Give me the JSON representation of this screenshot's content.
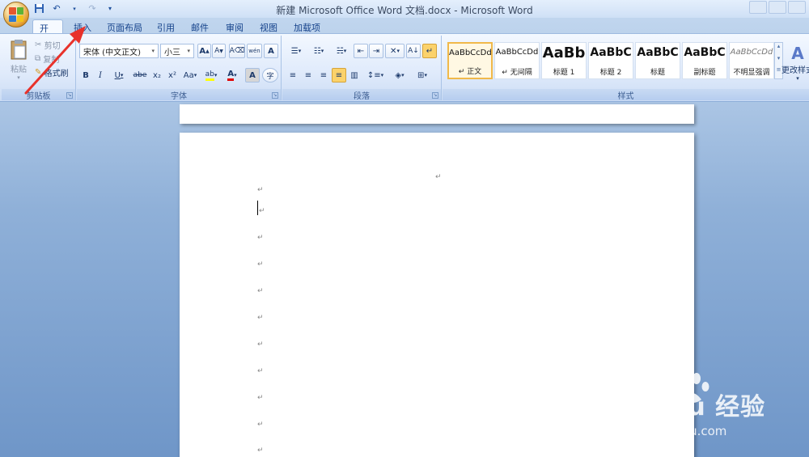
{
  "window": {
    "title": "新建 Microsoft Office Word 文档.docx - Microsoft Word"
  },
  "tabs": [
    {
      "label": "开始",
      "active": true
    },
    {
      "label": "插入",
      "active": false
    },
    {
      "label": "页面布局",
      "active": false
    },
    {
      "label": "引用",
      "active": false
    },
    {
      "label": "邮件",
      "active": false
    },
    {
      "label": "审阅",
      "active": false
    },
    {
      "label": "视图",
      "active": false
    },
    {
      "label": "加载项",
      "active": false
    }
  ],
  "clipboard": {
    "group_label": "剪贴板",
    "paste_label": "粘贴",
    "cut_label": "剪切",
    "copy_label": "复制",
    "format_painter_label": "格式刷"
  },
  "font": {
    "group_label": "字体",
    "font_name": "宋体 (中文正文)",
    "font_size": "小三",
    "grow_label": "A",
    "shrink_label": "A",
    "bold": "B",
    "italic": "I",
    "underline": "U",
    "strike": "abe",
    "subscript": "x₂",
    "superscript": "x²",
    "change_case": "Aa",
    "phonetic": "wén",
    "border_char": "A",
    "shading_char": "A",
    "enclose_char": "字"
  },
  "paragraph": {
    "group_label": "段落"
  },
  "styles": {
    "group_label": "样式",
    "change_label": "更改样式",
    "items": [
      {
        "sample": "AaBbCcDd",
        "name": "↵ 正文",
        "selected": true
      },
      {
        "sample": "AaBbCcDd",
        "name": "↵ 无间隔",
        "selected": false
      },
      {
        "sample": "AaBb",
        "name": "标题 1",
        "selected": false
      },
      {
        "sample": "AaBbC",
        "name": "标题 2",
        "selected": false
      },
      {
        "sample": "AaBbC",
        "name": "标题",
        "selected": false
      },
      {
        "sample": "AaBbC",
        "name": "副标题",
        "selected": false
      },
      {
        "sample": "AaBbCcDd",
        "name": "不明显强调",
        "selected": false
      }
    ]
  },
  "document": {
    "paragraph_mark": "↵"
  },
  "watermark": {
    "logo": "Bai du 经验",
    "url": "jingyan.baidu.com"
  },
  "colors": {
    "annotation_arrow": "#e8322b",
    "selected_style_border": "#f1b94a",
    "highlight_yellow": "#ffff00",
    "font_red": "#e00000"
  }
}
